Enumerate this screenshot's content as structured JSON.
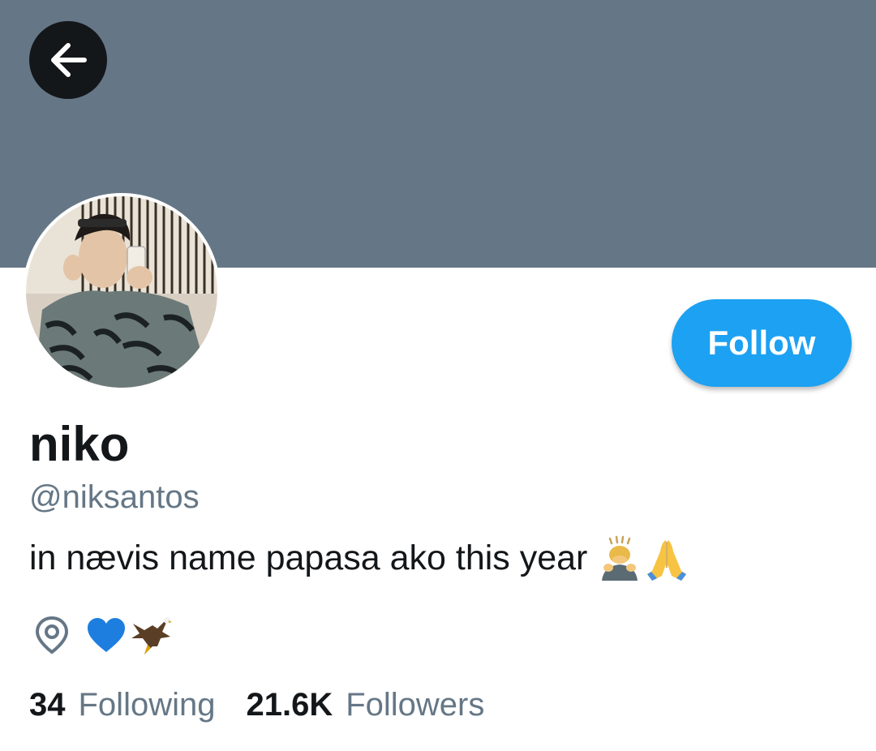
{
  "profile": {
    "display_name": "niko",
    "handle": "@niksantos",
    "bio": "in nævis name papasa ako this year",
    "bio_emoji": [
      "person-bowing-emoji",
      "folded-hands-emoji"
    ],
    "location_emoji": [
      "blue-heart-emoji",
      "eagle-emoji"
    ],
    "follow_label": "Follow"
  },
  "stats": {
    "following_count": "34",
    "following_label": "Following",
    "followers_count": "21.6K",
    "followers_label": "Followers"
  },
  "colors": {
    "banner": "#657786",
    "accent": "#1da1f2",
    "text_primary": "#14171a",
    "text_secondary": "#657786"
  },
  "icons": {
    "back": "back-arrow-icon",
    "location": "location-pin-icon"
  }
}
